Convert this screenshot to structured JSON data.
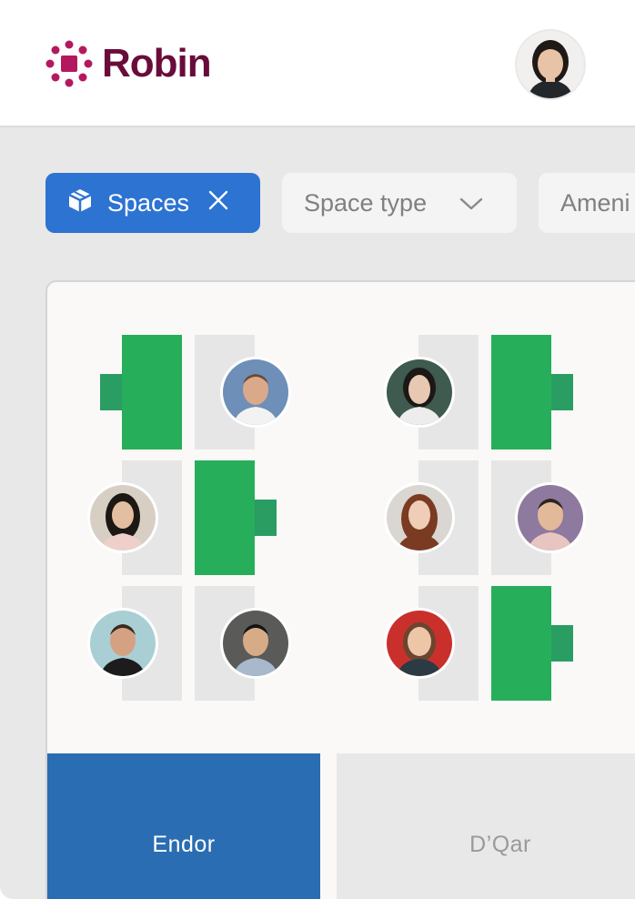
{
  "brand": {
    "name": "Robin",
    "color": "#6a0c3a"
  },
  "filters": {
    "spaces_label": "Spaces",
    "space_type_label": "Space type",
    "amenities_label": "Ameni",
    "active_color": "#2c73d2"
  },
  "map": {
    "rooms": [
      {
        "label": "Endor",
        "active": true
      },
      {
        "label": "D’Qar",
        "active": false
      }
    ],
    "desk_available_color": "#27ae5b",
    "chair_color": "#2a9d63"
  },
  "icons": {
    "logo": "robin-logo-icon",
    "spaces": "cube-icon",
    "close": "close-icon",
    "chevron": "chevron-down-icon"
  }
}
